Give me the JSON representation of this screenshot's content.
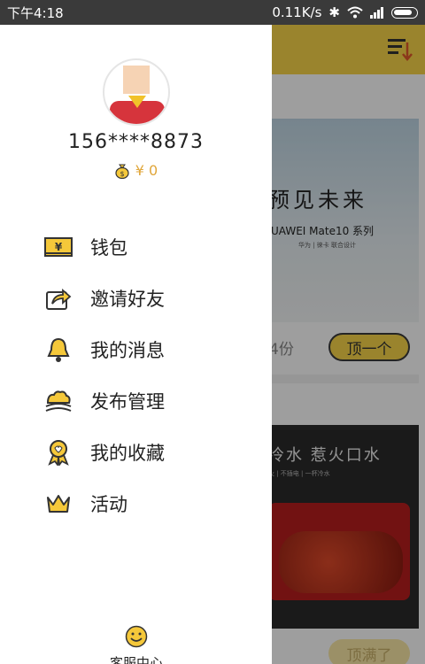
{
  "status_bar": {
    "time": "下午4:18",
    "speed": "0.11K/s"
  },
  "background": {
    "card1": {
      "title": "预见未来",
      "brand": "HUAWEI Mate10 系列",
      "sub": "华为 | 徕卡  联合设计",
      "share_count": "4份",
      "button": "顶一个"
    },
    "card2": {
      "title": "冷水  惹火口水",
      "sub": "火 | 不插电 | 一杯冷水",
      "button": "顶满了"
    },
    "accent": "#f8d64a"
  },
  "drawer": {
    "phone": "156****8873",
    "balance": "¥ 0",
    "menu": [
      {
        "label": "钱包",
        "icon": "wallet-icon"
      },
      {
        "label": "邀请好友",
        "icon": "share-icon"
      },
      {
        "label": "我的消息",
        "icon": "bell-icon"
      },
      {
        "label": "发布管理",
        "icon": "publish-icon"
      },
      {
        "label": "我的收藏",
        "icon": "medal-icon"
      },
      {
        "label": "活动",
        "icon": "crown-icon"
      }
    ],
    "service": {
      "label": "客服中心",
      "icon": "smile-icon"
    }
  }
}
